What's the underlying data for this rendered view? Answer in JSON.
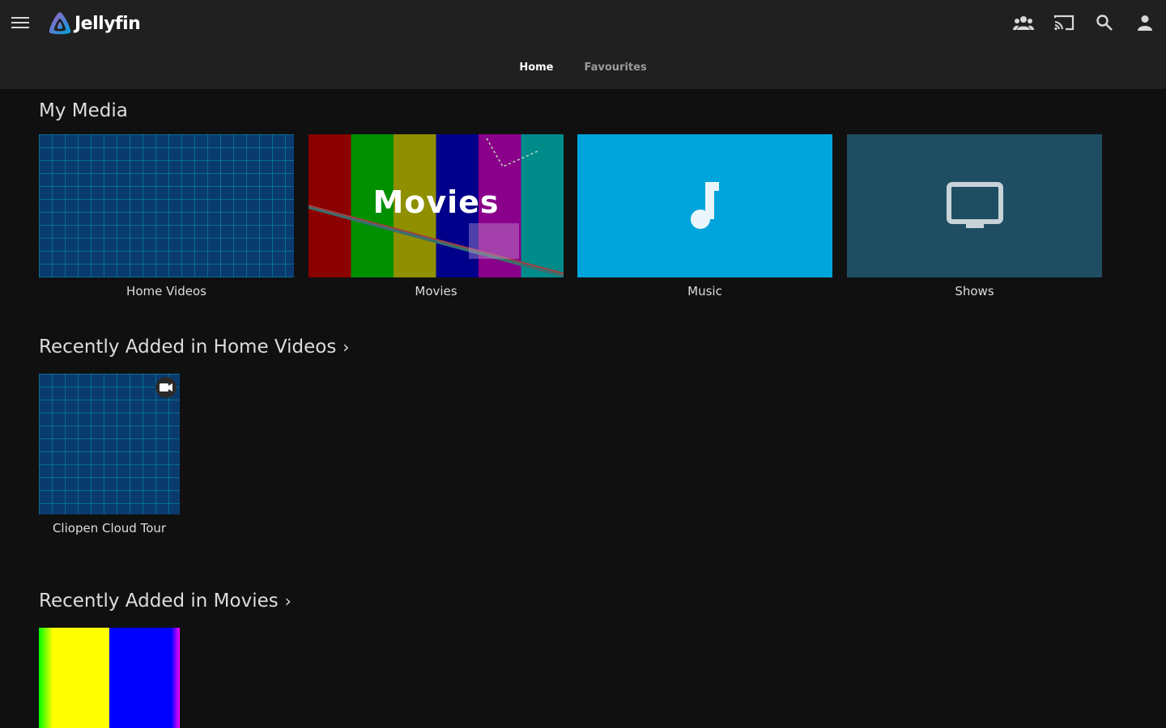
{
  "app": {
    "name": "Jellyfin"
  },
  "header": {
    "tabs": [
      {
        "label": "Home",
        "active": true
      },
      {
        "label": "Favourites",
        "active": false
      }
    ],
    "icons": [
      "menu-icon",
      "users-icon",
      "cast-icon",
      "search-icon",
      "user-icon"
    ]
  },
  "my_media": {
    "title": "My Media",
    "items": [
      {
        "label": "Home Videos",
        "style": "grid"
      },
      {
        "label": "Movies",
        "overlay_text": "Movies",
        "style": "bars"
      },
      {
        "label": "Music",
        "icon": "music-note-icon",
        "color": "#00a4dc"
      },
      {
        "label": "Shows",
        "icon": "tv-icon",
        "color": "#1f4e63"
      }
    ]
  },
  "recent_home_videos": {
    "title": "Recently Added in Home Videos",
    "items": [
      {
        "label": "Cliopen Cloud Tour",
        "badge_icon": "video-camera-icon"
      }
    ]
  },
  "recent_movies": {
    "title": "Recently Added in Movies",
    "items": [
      {
        "label": ""
      }
    ]
  },
  "colors": {
    "background": "#101010",
    "header": "#202020",
    "accent": "#00a4dc"
  }
}
